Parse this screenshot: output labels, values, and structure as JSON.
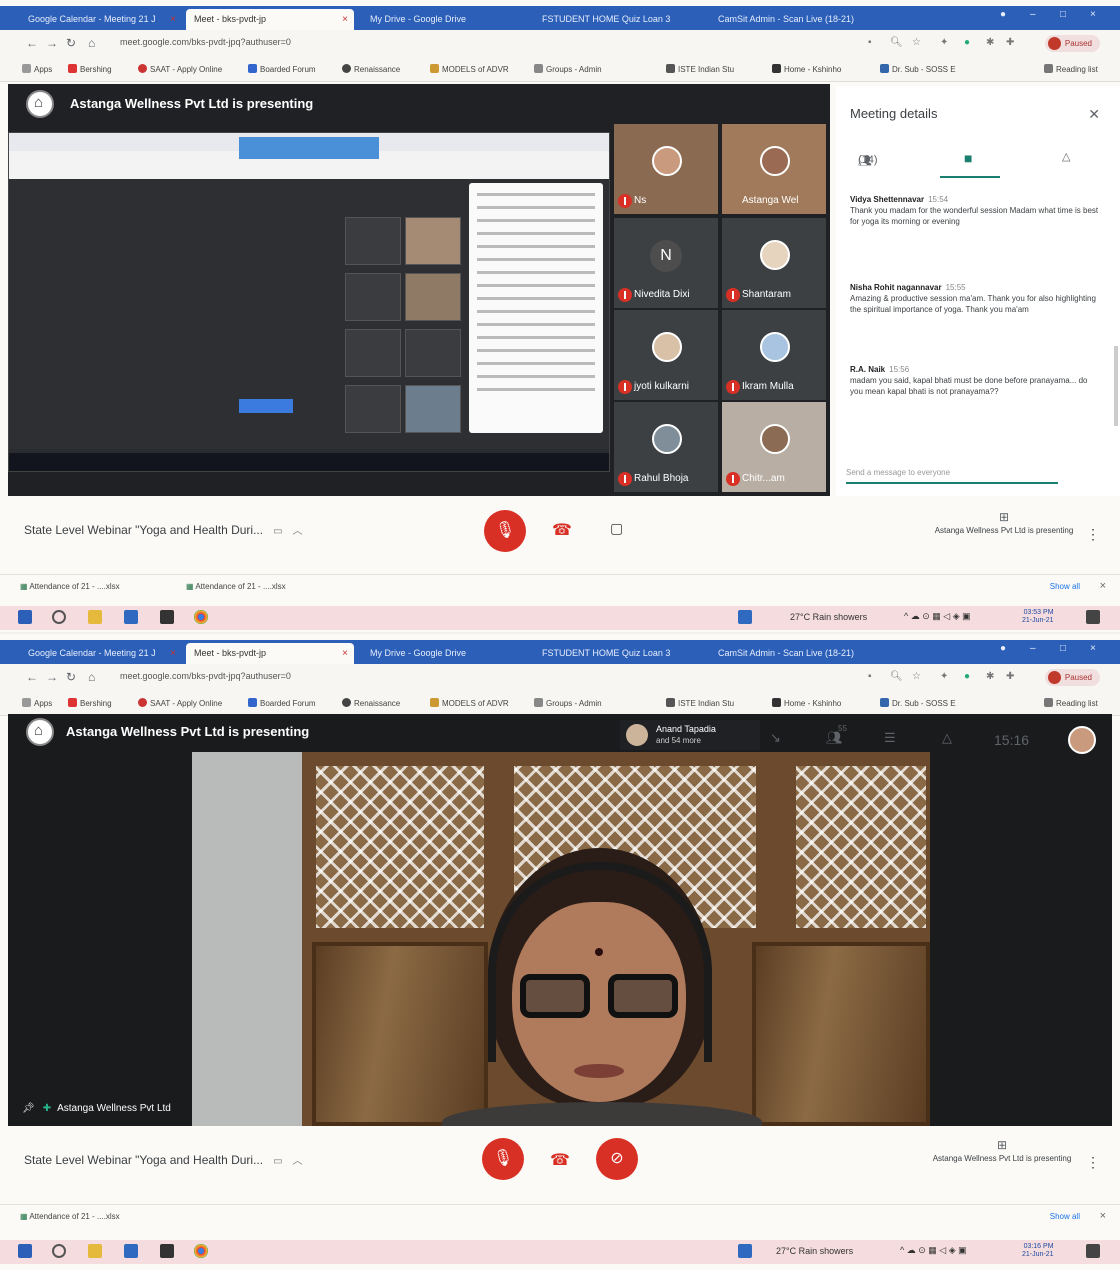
{
  "screen1": {
    "tabs": [
      "Google Calendar - Meeting 21 J",
      "Meet - bks-pvdt-jp",
      "My Drive - Google Drive",
      "FSTUDENT HOME Quiz Loan 3",
      "CamSit Admin - Scan Live (18-21)"
    ],
    "url": "meet.google.com/bks-pvdt-jpq?authuser=0",
    "paused_label": "Paused",
    "bookmarks": [
      "Apps",
      "Bershing",
      "SAAT - Apply Online",
      "Boarded Forum",
      "Renaissance",
      "MODELS of ADVR",
      "Groups - Admin",
      "ISTE Indian Stu",
      "Home - Kshinho",
      "Dr. Sub - SOSS E",
      "Reading list"
    ],
    "presenting_title": "Astanga Wellness Pvt Ltd is presenting",
    "tiles": [
      {
        "name": "Ns",
        "type": "cam"
      },
      {
        "name": "Astanga Wel",
        "type": "cam"
      },
      {
        "name": "Nivedita Dixi",
        "initial": "N"
      },
      {
        "name": "Shantaram",
        "type": "photo"
      },
      {
        "name": "jyoti kulkarni",
        "type": "photo"
      },
      {
        "name": "Ikram Mulla",
        "type": "photo"
      },
      {
        "name": "Rahul Bhoja",
        "type": "photo"
      },
      {
        "name": "Chitr...am",
        "type": "cam"
      }
    ],
    "panel": {
      "title": "Meeting details",
      "people_count": "(14)",
      "messages": [
        {
          "author": "Vidya Shettennavar",
          "time": "15:54",
          "text": "Thank you madam for the wonderful session Madam what time is best for yoga its morning or evening"
        },
        {
          "author": "Nisha Rohit nagannavar",
          "time": "15:55",
          "text": "Amazing & productive session ma'am. Thank you for also highlighting the spiritual importance of yoga. Thank you ma'am"
        },
        {
          "author": "R.A. Naik",
          "time": "15:56",
          "text": "madam you said, kapal bhati must be done before pranayama... do you mean kapal bhati is not pranayama??"
        }
      ],
      "send_placeholder": "Send a message to everyone"
    },
    "meeting_name": "State Level Webinar \"Yoga and Health Duri...",
    "presenting_badge": "Astanga Wellness Pvt Ltd is presenting",
    "download": [
      "Attendance of 21 - ....xlsx",
      "Attendance of 21 - ....xlsx"
    ],
    "show_all": "Show all",
    "weather": "27°C Rain showers",
    "clock_time": "03:53 PM",
    "clock_date": "21-Jun-21"
  },
  "screen2": {
    "tabs": [
      "Google Calendar - Meeting 21 J",
      "Meet - bks-pvdt-jp",
      "My Drive - Google Drive",
      "FSTUDENT HOME Quiz Loan 3",
      "CamSit Admin - Scan Live (18-21)"
    ],
    "url": "meet.google.com/bks-pvdt-jpq?authuser=0",
    "paused_label": "Paused",
    "bookmarks": [
      "Apps",
      "Bershing",
      "SAAT - Apply Online",
      "Boarded Forum",
      "Renaissance",
      "MODELS of ADVR",
      "Groups - Admin",
      "ISTE Indian Stu",
      "Home - Kshinho",
      "Dr. Sub - SOSS E",
      "Reading list"
    ],
    "presenting_title": "Astanga Wellness Pvt Ltd is presenting",
    "top_participant": {
      "name": "Anand Tapadia",
      "sub": "and 54 more"
    },
    "people_count": "55",
    "time": "15:16",
    "speaker_label": "Astanga Wellness Pvt Ltd",
    "meeting_name": "State Level Webinar \"Yoga and Health Duri...",
    "presenting_badge": "Astanga Wellness Pvt Ltd is presenting",
    "download": [
      "Attendance of 21 - ....xlsx"
    ],
    "show_all": "Show all",
    "weather": "27°C Rain showers",
    "clock_time": "03:16 PM",
    "clock_date": "21-Jun-21"
  },
  "colors": {
    "accent": "#1a7f6e",
    "danger": "#d93025",
    "chrome": "#2b5fb8",
    "stage": "#202124",
    "taskbar": "#f5dcdf"
  },
  "icons": [
    "back-icon",
    "forward-icon",
    "reload-icon",
    "home-icon",
    "lock-icon",
    "star-icon",
    "people-icon",
    "chat-icon",
    "activities-icon",
    "close-icon",
    "mic-off-icon",
    "hangup-icon",
    "camera-icon",
    "present-icon",
    "more-icon",
    "windows-icon",
    "search-icon",
    "chrome-icon"
  ]
}
